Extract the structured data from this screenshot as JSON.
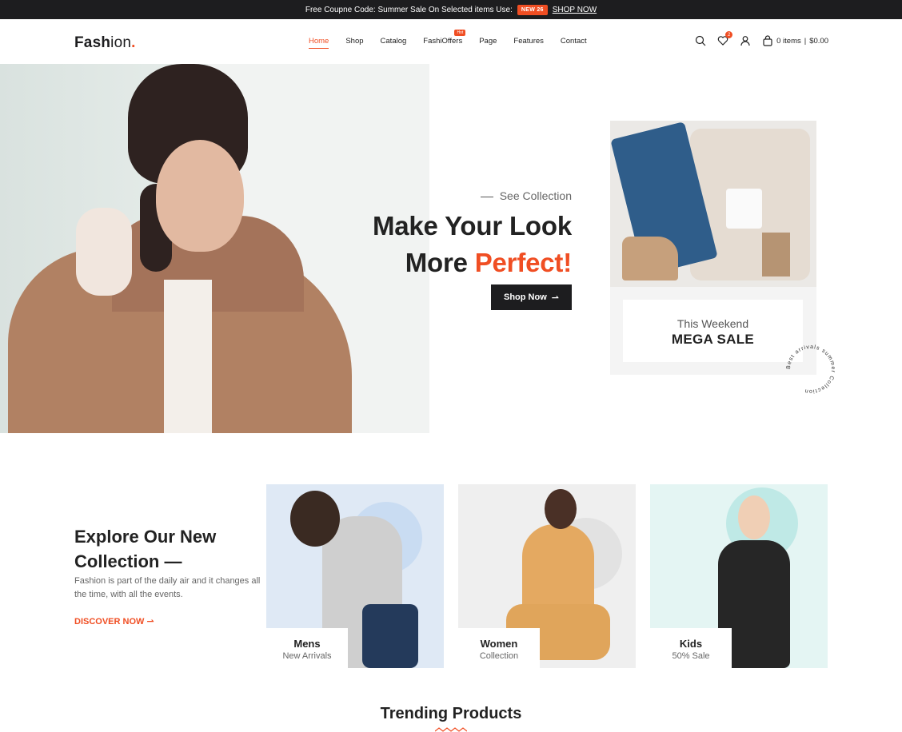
{
  "promo_bar": {
    "text": "Free Coupne Code: Summer Sale On Selected items Use:",
    "code": "NEW 26",
    "link": "SHOP NOW"
  },
  "header": {
    "logo_bold": "Fash",
    "logo_light": "ion",
    "logo_dot": ".",
    "nav": [
      {
        "label": "Home",
        "active": true
      },
      {
        "label": "Shop"
      },
      {
        "label": "Catalog"
      },
      {
        "label": "FashiOffers",
        "badge": "Hot"
      },
      {
        "label": "Page"
      },
      {
        "label": "Features"
      },
      {
        "label": "Contact"
      }
    ],
    "wishlist_count": "2",
    "cart_items": "0 items",
    "cart_total": "$0.00"
  },
  "hero": {
    "eyebrow": "See Collection",
    "headline_line1": "Make Your Look",
    "headline_line2_prefix": "More",
    "headline_line2_accent": "Perfect!",
    "cta": "Shop Now",
    "promo_card": {
      "small": "This Weekend",
      "big": "MEGA SALE"
    },
    "ring_text": "Best arrivals summer Collection"
  },
  "collection": {
    "title_line1": "Explore Our New",
    "title_line2": "Collection —",
    "description": "Fashion is part of the daily air and it changes all the time, with all the events.",
    "discover": "DISCOVER NOW",
    "categories": [
      {
        "title": "Mens",
        "subtitle": "New Arrivals"
      },
      {
        "title": "Women",
        "subtitle": "Collection"
      },
      {
        "title": "Kids",
        "subtitle": "50% Sale"
      }
    ]
  },
  "trending": {
    "title": "Trending Products"
  },
  "colors": {
    "accent": "#f04e23",
    "dark": "#1d1d1f"
  }
}
